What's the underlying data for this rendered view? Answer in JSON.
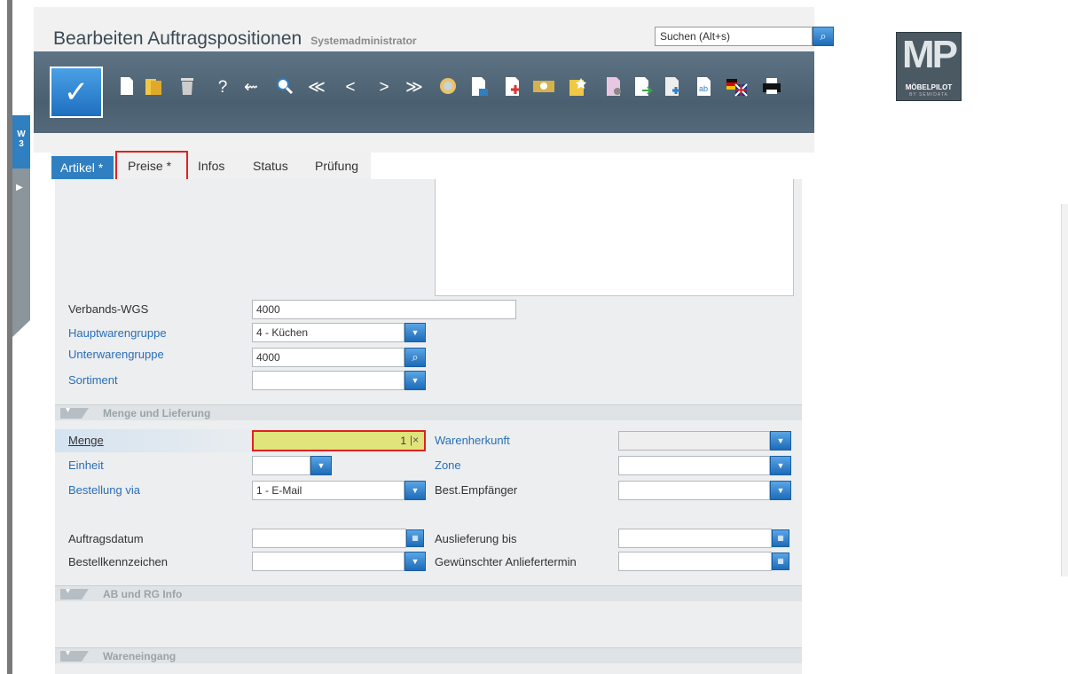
{
  "header": {
    "title": "Bearbeiten Auftragspositionen",
    "user": "Systemadministrator",
    "search_placeholder": "Suchen (Alt+s)"
  },
  "side_tab": {
    "label": "W\n3"
  },
  "toolbar": {
    "icons": [
      "new-document-icon",
      "open-folder-icon",
      "trash-icon",
      "help-icon",
      "back-arrow-icon",
      "search-zoom-icon",
      "first-record-icon",
      "previous-record-icon",
      "next-record-icon",
      "last-record-icon",
      "coins-icon",
      "document-user-icon",
      "document-add-icon",
      "money-icon",
      "folder-star-icon",
      "document-settings-icon",
      "document-export-icon",
      "document-plus-icon",
      "document-translate-icon",
      "language-flag-icon",
      "print-icon"
    ],
    "glyphs": {
      "help": "?",
      "back": "⇜",
      "prev_all": "≪",
      "prev": "<",
      "next": ">",
      "next_all": "≫"
    }
  },
  "logo": {
    "mark": "MP",
    "name": "MÖBELPILOT",
    "sub": "BY SEMIDATA"
  },
  "tabs": [
    "Artikel *",
    "Preise *",
    "Infos",
    "Status",
    "Prüfung"
  ],
  "article": {
    "verbands_wgs_label": "Verbands-WGS",
    "verbands_wgs_value": "4000",
    "hauptwarengruppe_label": "Hauptwarengruppe",
    "hauptwarengruppe_value": "4 - Küchen",
    "unterwarengruppe_label": "Unterwarengruppe",
    "unterwarengruppe_value": "4000",
    "sortiment_label": "Sortiment",
    "sortiment_value": ""
  },
  "sections": {
    "menge": "Menge und Lieferung",
    "ab": "AB und RG Info",
    "wareneingang": "Wareneingang"
  },
  "delivery": {
    "menge_label": "Menge",
    "menge_value": "1",
    "einheit_label": "Einheit",
    "einheit_value": "",
    "bestellung_label": "Bestellung via",
    "bestellung_value": "1 - E-Mail",
    "warenherkunft_label": "Warenherkunft",
    "zone_label": "Zone",
    "empfaenger_label": "Best.Empfänger",
    "auftragsdatum_label": "Auftragsdatum",
    "bestellkennzeichen_label": "Bestellkennzeichen",
    "auslieferung_label": "Auslieferung bis",
    "anliefertermin_label": "Gewünschter Anliefertermin"
  },
  "colors": {
    "accent": "#2f7fc1",
    "toolbar": "#4a5f70",
    "highlight_border": "#dd2222",
    "menge_field": "#e0e47a"
  }
}
